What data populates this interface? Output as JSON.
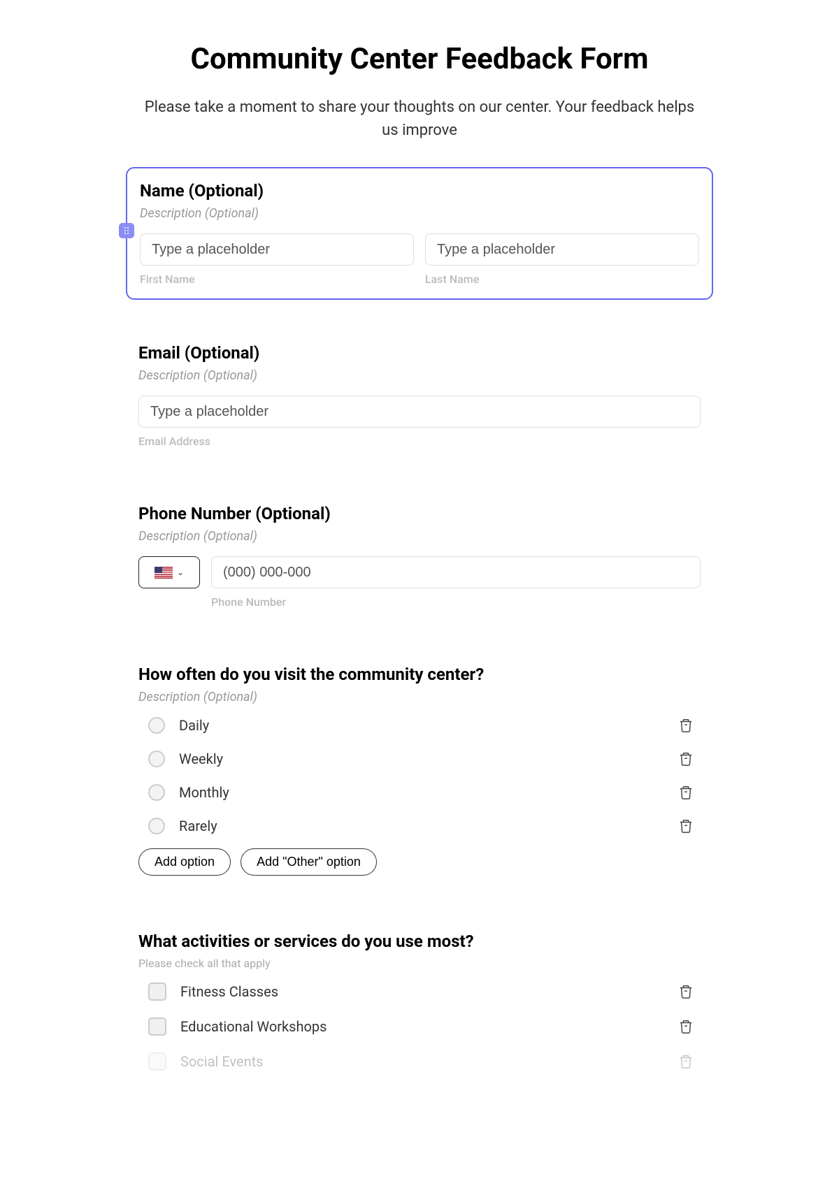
{
  "form": {
    "title": "Community Center Feedback Form",
    "subtitle": "Please take a moment to share your thoughts on our center. Your feedback helps us improve"
  },
  "name_block": {
    "label": "Name (Optional)",
    "description_placeholder": "Description (Optional)",
    "first": {
      "placeholder": "Type a placeholder",
      "sublabel": "First Name"
    },
    "last": {
      "placeholder": "Type a placeholder",
      "sublabel": "Last Name"
    }
  },
  "email_block": {
    "label": "Email (Optional)",
    "description_placeholder": "Description (Optional)",
    "input": {
      "placeholder": "Type a placeholder",
      "sublabel": "Email Address"
    }
  },
  "phone_block": {
    "label": "Phone Number (Optional)",
    "description_placeholder": "Description (Optional)",
    "input": {
      "placeholder": "(000) 000-000",
      "sublabel": "Phone Number"
    }
  },
  "visit_block": {
    "label": "How often do you visit the community center?",
    "description_placeholder": "Description (Optional)",
    "options": [
      "Daily",
      "Weekly",
      "Monthly",
      "Rarely"
    ],
    "add_option": "Add option",
    "add_other": "Add \"Other\" option"
  },
  "activities_block": {
    "label": "What activities or services do you use most?",
    "description": "Please check all that apply",
    "options": [
      "Fitness Classes",
      "Educational Workshops",
      "Social Events"
    ]
  }
}
